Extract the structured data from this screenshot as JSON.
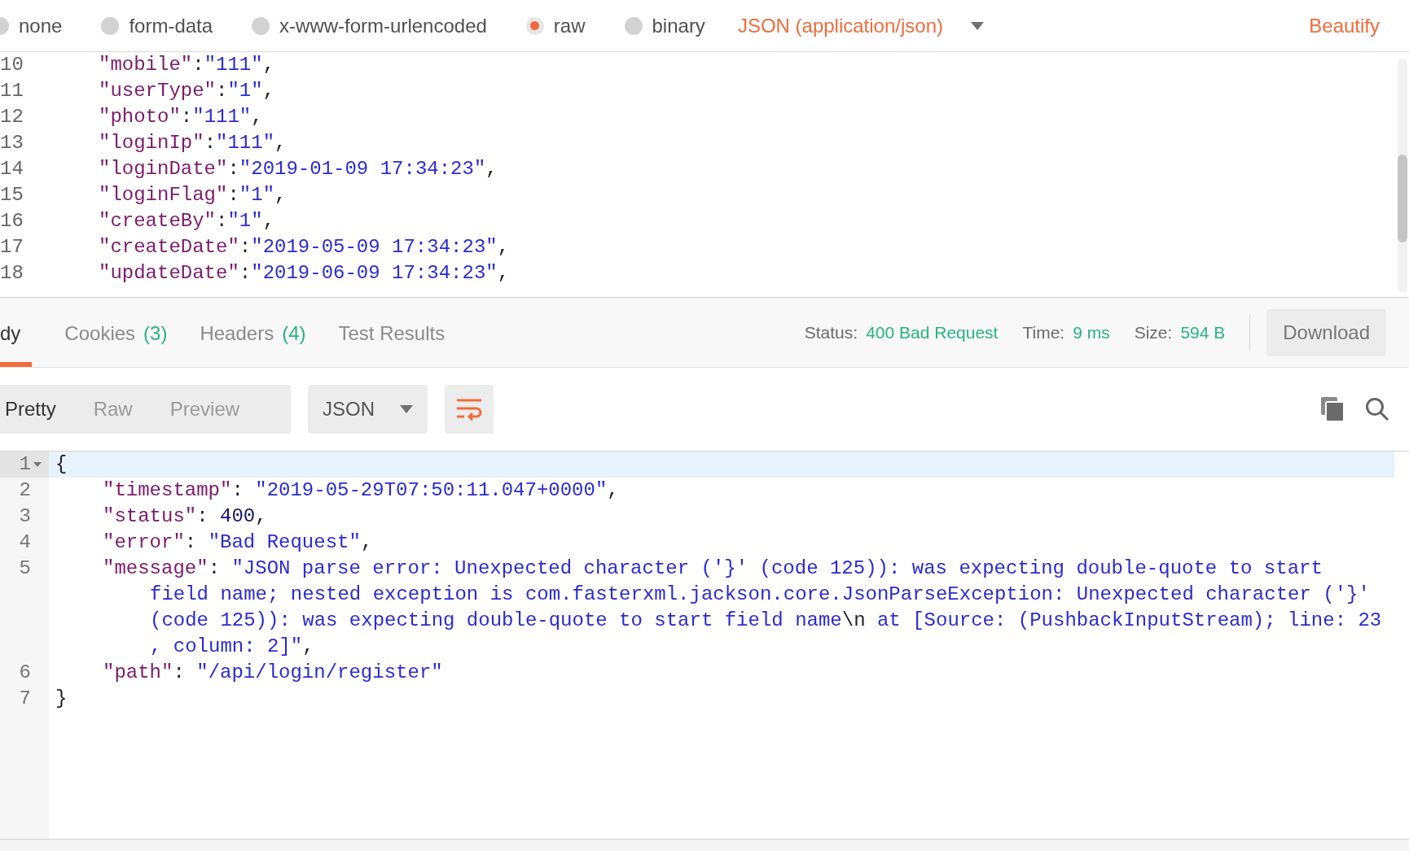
{
  "body_types": [
    {
      "label": "none",
      "selected": false
    },
    {
      "label": "form-data",
      "selected": false
    },
    {
      "label": "x-www-form-urlencoded",
      "selected": false
    },
    {
      "label": "raw",
      "selected": true
    },
    {
      "label": "binary",
      "selected": false
    }
  ],
  "content_type": "JSON (application/json)",
  "beautify": "Beautify",
  "request_editor": {
    "lines": [
      {
        "number": "10",
        "tokens": [
          {
            "kind": "key",
            "text": "\"mobile\""
          },
          {
            "kind": "punct",
            "text": ":"
          },
          {
            "kind": "string",
            "text": "\"111\""
          },
          {
            "kind": "punct",
            "text": ","
          }
        ]
      },
      {
        "number": "11",
        "tokens": [
          {
            "kind": "key",
            "text": "\"userType\""
          },
          {
            "kind": "punct",
            "text": ":"
          },
          {
            "kind": "string",
            "text": "\"1\""
          },
          {
            "kind": "punct",
            "text": ","
          }
        ]
      },
      {
        "number": "12",
        "tokens": [
          {
            "kind": "key",
            "text": "\"photo\""
          },
          {
            "kind": "punct",
            "text": ":"
          },
          {
            "kind": "string",
            "text": "\"111\""
          },
          {
            "kind": "punct",
            "text": ","
          }
        ]
      },
      {
        "number": "13",
        "tokens": [
          {
            "kind": "key",
            "text": "\"loginIp\""
          },
          {
            "kind": "punct",
            "text": ":"
          },
          {
            "kind": "string",
            "text": "\"111\""
          },
          {
            "kind": "punct",
            "text": ","
          }
        ]
      },
      {
        "number": "14",
        "tokens": [
          {
            "kind": "key",
            "text": "\"loginDate\""
          },
          {
            "kind": "punct",
            "text": ":"
          },
          {
            "kind": "string",
            "text": "\"2019-01-09 17:34:23\""
          },
          {
            "kind": "punct",
            "text": ","
          }
        ]
      },
      {
        "number": "15",
        "tokens": [
          {
            "kind": "key",
            "text": "\"loginFlag\""
          },
          {
            "kind": "punct",
            "text": ":"
          },
          {
            "kind": "string",
            "text": "\"1\""
          },
          {
            "kind": "punct",
            "text": ","
          }
        ]
      },
      {
        "number": "16",
        "tokens": [
          {
            "kind": "key",
            "text": "\"createBy\""
          },
          {
            "kind": "punct",
            "text": ":"
          },
          {
            "kind": "string",
            "text": "\"1\""
          },
          {
            "kind": "punct",
            "text": ","
          }
        ]
      },
      {
        "number": "17",
        "tokens": [
          {
            "kind": "key",
            "text": "\"createDate\""
          },
          {
            "kind": "punct",
            "text": ":"
          },
          {
            "kind": "string",
            "text": "\"2019-05-09 17:34:23\""
          },
          {
            "kind": "punct",
            "text": ","
          }
        ]
      },
      {
        "number": "18",
        "tokens": [
          {
            "kind": "key",
            "text": "\"updateDate\""
          },
          {
            "kind": "punct",
            "text": ":"
          },
          {
            "kind": "string",
            "text": "\"2019-06-09 17:34:23\""
          },
          {
            "kind": "punct",
            "text": ","
          }
        ]
      }
    ]
  },
  "response_tabs": [
    {
      "label": "dy",
      "selected": true
    },
    {
      "label": "Cookies",
      "count": "(3)",
      "selected": false
    },
    {
      "label": "Headers",
      "count": "(4)",
      "selected": false
    },
    {
      "label": "Test Results",
      "selected": false
    }
  ],
  "response_meta": [
    {
      "label": "Status:",
      "value": "400 Bad Request"
    },
    {
      "label": "Time:",
      "value": "9 ms"
    },
    {
      "label": "Size:",
      "value": "594 B"
    }
  ],
  "download": "Download",
  "view_modes": [
    {
      "label": "Pretty",
      "selected": true
    },
    {
      "label": "Raw",
      "selected": false
    },
    {
      "label": "Preview",
      "selected": false
    }
  ],
  "format": "JSON",
  "wrap_lines": true,
  "response_editor": {
    "lines": [
      {
        "number": "1",
        "active": true,
        "foldable": true,
        "indent": false,
        "rows": [
          {
            "tokens": [
              {
                "kind": "punct",
                "text": "{"
              }
            ]
          }
        ]
      },
      {
        "number": "2",
        "active": false,
        "foldable": false,
        "indent": true,
        "rows": [
          {
            "tokens": [
              {
                "kind": "key",
                "text": "\"timestamp\""
              },
              {
                "kind": "punct",
                "text": ": "
              },
              {
                "kind": "string",
                "text": "\"2019-05-29T07:50:11.047+0000\""
              },
              {
                "kind": "punct",
                "text": ","
              }
            ]
          }
        ]
      },
      {
        "number": "3",
        "active": false,
        "foldable": false,
        "indent": true,
        "rows": [
          {
            "tokens": [
              {
                "kind": "key",
                "text": "\"status\""
              },
              {
                "kind": "punct",
                "text": ": "
              },
              {
                "kind": "number",
                "text": "400"
              },
              {
                "kind": "punct",
                "text": ","
              }
            ]
          }
        ]
      },
      {
        "number": "4",
        "active": false,
        "foldable": false,
        "indent": true,
        "rows": [
          {
            "tokens": [
              {
                "kind": "key",
                "text": "\"error\""
              },
              {
                "kind": "punct",
                "text": ": "
              },
              {
                "kind": "string",
                "text": "\"Bad Request\""
              },
              {
                "kind": "punct",
                "text": ","
              }
            ]
          }
        ]
      },
      {
        "number": "5",
        "active": false,
        "foldable": false,
        "indent": true,
        "rows": [
          {
            "tokens": [
              {
                "kind": "key",
                "text": "\"message\""
              },
              {
                "kind": "punct",
                "text": ": "
              },
              {
                "kind": "string",
                "text": "\"JSON parse error: Unexpected character ('}' (code 125)): was expecting double-quote to start"
              }
            ]
          },
          {
            "tokens": [
              {
                "kind": "string",
                "text": "field name; nested exception is com.fasterxml.jackson.core.JsonParseException: Unexpected character ('}'"
              }
            ]
          },
          {
            "tokens": [
              {
                "kind": "string",
                "text": "(code 125)): was expecting double-quote to start field name"
              },
              {
                "kind": "escape",
                "text": "\\n"
              },
              {
                "kind": "string",
                "text": " at [Source: (PushbackInputStream); line: 23"
              }
            ]
          },
          {
            "tokens": [
              {
                "kind": "string",
                "text": ", column: 2]\""
              },
              {
                "kind": "punct",
                "text": ","
              }
            ]
          }
        ]
      },
      {
        "number": "6",
        "active": false,
        "foldable": false,
        "indent": true,
        "rows": [
          {
            "tokens": [
              {
                "kind": "key",
                "text": "\"path\""
              },
              {
                "kind": "punct",
                "text": ": "
              },
              {
                "kind": "string",
                "text": "\"/api/login/register\""
              }
            ]
          }
        ]
      },
      {
        "number": "7",
        "active": false,
        "foldable": false,
        "indent": false,
        "rows": [
          {
            "tokens": [
              {
                "kind": "punct",
                "text": "}"
              }
            ]
          }
        ]
      }
    ]
  }
}
